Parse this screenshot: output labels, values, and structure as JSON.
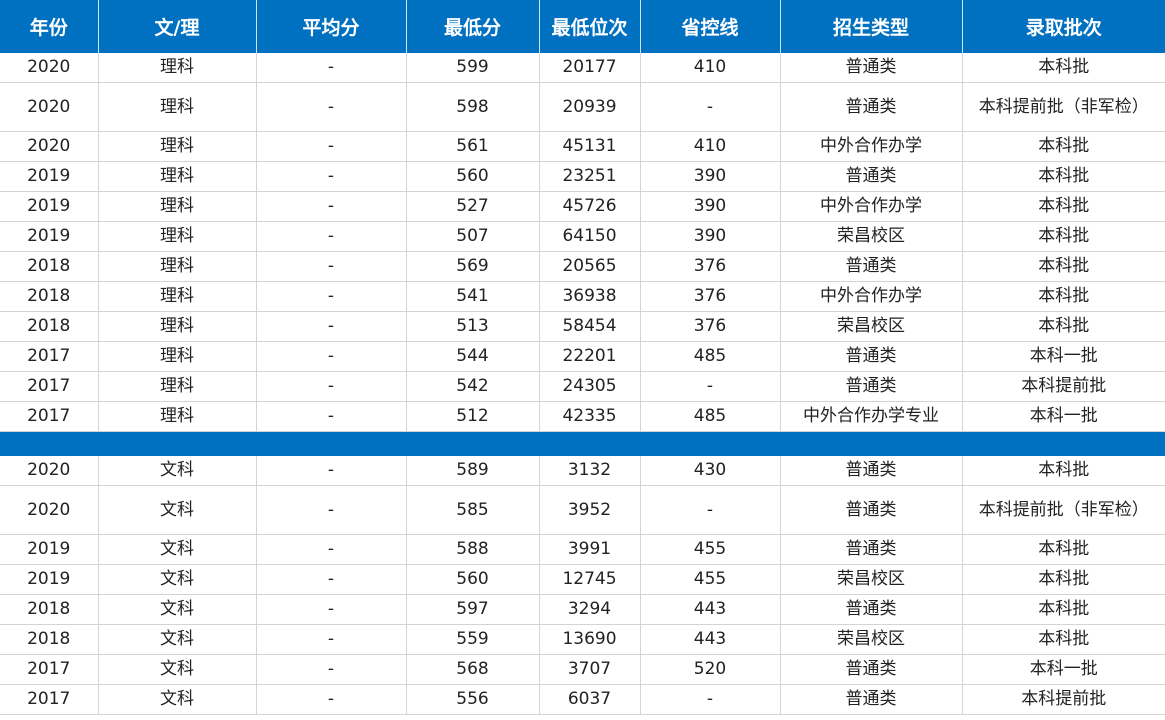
{
  "header": {
    "columns": [
      "年份",
      "文/理",
      "平均分",
      "最低分",
      "最低位次",
      "省控线",
      "招生类型",
      "录取批次"
    ]
  },
  "science_rows": [
    [
      "2020",
      "理科",
      "-",
      "599",
      "20177",
      "410",
      "普通类",
      "本科批"
    ],
    [
      "2020",
      "理科",
      "-",
      "598",
      "20939",
      "-",
      "普通类",
      "本科提前批（非军检）"
    ],
    [
      "2020",
      "理科",
      "-",
      "561",
      "45131",
      "410",
      "中外合作办学",
      "本科批"
    ],
    [
      "2019",
      "理科",
      "-",
      "560",
      "23251",
      "390",
      "普通类",
      "本科批"
    ],
    [
      "2019",
      "理科",
      "-",
      "527",
      "45726",
      "390",
      "中外合作办学",
      "本科批"
    ],
    [
      "2019",
      "理科",
      "-",
      "507",
      "64150",
      "390",
      "荣昌校区",
      "本科批"
    ],
    [
      "2018",
      "理科",
      "-",
      "569",
      "20565",
      "376",
      "普通类",
      "本科批"
    ],
    [
      "2018",
      "理科",
      "-",
      "541",
      "36938",
      "376",
      "中外合作办学",
      "本科批"
    ],
    [
      "2018",
      "理科",
      "-",
      "513",
      "58454",
      "376",
      "荣昌校区",
      "本科批"
    ],
    [
      "2017",
      "理科",
      "-",
      "544",
      "22201",
      "485",
      "普通类",
      "本科一批"
    ],
    [
      "2017",
      "理科",
      "-",
      "542",
      "24305",
      "-",
      "普通类",
      "本科提前批"
    ],
    [
      "2017",
      "理科",
      "-",
      "512",
      "42335",
      "485",
      "中外合作办学专业",
      "本科一批"
    ]
  ],
  "arts_rows": [
    [
      "2020",
      "文科",
      "-",
      "589",
      "3132",
      "430",
      "普通类",
      "本科批"
    ],
    [
      "2020",
      "文科",
      "-",
      "585",
      "3952",
      "-",
      "普通类",
      "本科提前批（非军检）"
    ],
    [
      "2019",
      "文科",
      "-",
      "588",
      "3991",
      "455",
      "普通类",
      "本科批"
    ],
    [
      "2019",
      "文科",
      "-",
      "560",
      "12745",
      "455",
      "荣昌校区",
      "本科批"
    ],
    [
      "2018",
      "文科",
      "-",
      "597",
      "3294",
      "443",
      "普通类",
      "本科批"
    ],
    [
      "2018",
      "文科",
      "-",
      "559",
      "13690",
      "443",
      "荣昌校区",
      "本科批"
    ],
    [
      "2017",
      "文科",
      "-",
      "568",
      "3707",
      "520",
      "普通类",
      "本科一批"
    ],
    [
      "2017",
      "文科",
      "-",
      "556",
      "6037",
      "-",
      "普通类",
      "本科提前批"
    ]
  ],
  "colors": {
    "header_bg": "#0070c0",
    "header_text": "#ffffff",
    "separator_bg": "#0070c0",
    "grid_line": "#d4d4d4"
  }
}
